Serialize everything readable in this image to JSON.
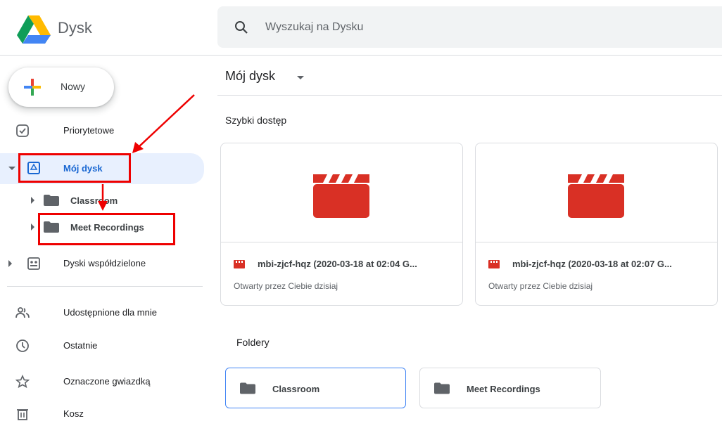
{
  "header": {
    "app_title": "Dysk",
    "search_placeholder": "Wyszukaj na Dysku"
  },
  "sidebar": {
    "new_button": "Nowy",
    "items": [
      {
        "label": "Priorytetowe",
        "icon": "check-circle-icon"
      },
      {
        "label": "Mój dysk",
        "icon": "my-drive-icon"
      },
      {
        "label": "Dyski współdzielone",
        "icon": "shared-drives-icon"
      },
      {
        "label": "Udostępnione dla mnie",
        "icon": "people-icon"
      },
      {
        "label": "Ostatnie",
        "icon": "clock-icon"
      },
      {
        "label": "Oznaczone gwiazdką",
        "icon": "star-icon"
      },
      {
        "label": "Kosz",
        "icon": "trash-icon"
      }
    ],
    "tree": [
      {
        "label": "Classroom"
      },
      {
        "label": "Meet Recordings"
      }
    ]
  },
  "main": {
    "breadcrumb": "Mój dysk",
    "quick_access_title": "Szybki dostęp",
    "quick_access": [
      {
        "name": "mbi-zjcf-hqz (2020-03-18 at 02:04 G...",
        "meta": "Otwarty przez Ciebie dzisiaj"
      },
      {
        "name": "mbi-zjcf-hqz (2020-03-18 at 02:07 G...",
        "meta": "Otwarty przez Ciebie dzisiaj"
      }
    ],
    "folders_title": "Foldery",
    "folders": [
      {
        "name": "Classroom"
      },
      {
        "name": "Meet Recordings"
      }
    ]
  },
  "colors": {
    "accent": "#1967d2",
    "active_bg": "#e8f0fe",
    "video_red": "#d93025",
    "annotation_red": "#ee0000"
  }
}
